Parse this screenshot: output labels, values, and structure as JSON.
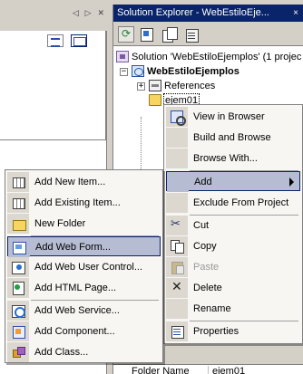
{
  "solution_explorer": {
    "title": "Solution Explorer - WebEstiloEje...",
    "close_glyph": "×",
    "solution_label": "Solution 'WebEstiloEjemplos' (1 projec",
    "project_label": "WebEstiloEjemplos",
    "references_label": "References",
    "folder_label": "ejem01"
  },
  "editor": {
    "tab_arrows": "◁ ▷ ✕"
  },
  "properties": {
    "name_label": "Folder Name",
    "name_value": "ejem01"
  },
  "context_menu": {
    "items": [
      {
        "label": "View in Browser"
      },
      {
        "label": "Build and Browse"
      },
      {
        "label": "Browse With..."
      },
      {
        "label": "Add"
      },
      {
        "label": "Exclude From Project"
      },
      {
        "label": "Cut"
      },
      {
        "label": "Copy"
      },
      {
        "label": "Paste"
      },
      {
        "label": "Delete"
      },
      {
        "label": "Rename"
      },
      {
        "label": "Properties"
      }
    ]
  },
  "add_submenu": {
    "items": [
      {
        "label": "Add New Item..."
      },
      {
        "label": "Add Existing Item..."
      },
      {
        "label": "New Folder"
      },
      {
        "label": "Add Web Form..."
      },
      {
        "label": "Add Web User Control..."
      },
      {
        "label": "Add HTML Page..."
      },
      {
        "label": "Add Web Service..."
      },
      {
        "label": "Add Component..."
      },
      {
        "label": "Add Class..."
      }
    ],
    "highlighted_index": 3
  },
  "colors": {
    "title_bar": "#0a246a",
    "menu_highlight": "#b6bdd2",
    "chrome": "#d4d0c8"
  }
}
